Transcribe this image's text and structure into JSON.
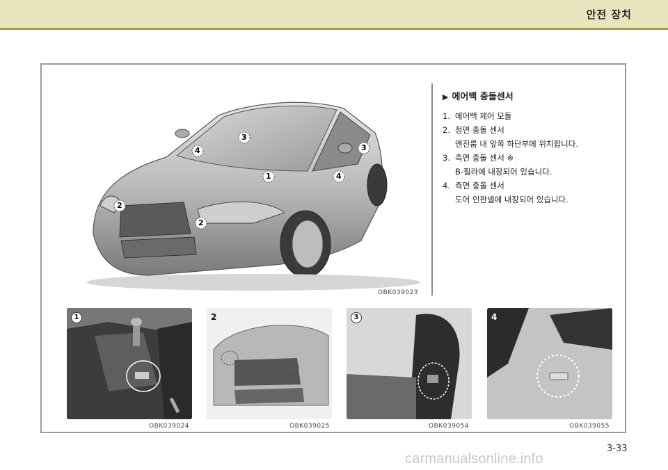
{
  "header": {
    "section_title": "안전 장치"
  },
  "main_figure": {
    "code": "OBK039023",
    "callouts": [
      "1",
      "2",
      "2",
      "3",
      "3",
      "4",
      "4"
    ]
  },
  "legend": {
    "title": "에어백 충돌센서",
    "items": [
      {
        "num": "1.",
        "text": "에어백 제어 모듈"
      },
      {
        "num": "2.",
        "text": "정면 충돌 센서",
        "sub": "엔진룸 내 앞쪽 하단부에 위치합니다."
      },
      {
        "num": "3.",
        "text": "측면 충돌 센서 ※",
        "sub": "B-필라에 내장되어 있습니다."
      },
      {
        "num": "4.",
        "text": "측면 충돌 센서",
        "sub": "도어 인판넬에 내장되어 있습니다."
      }
    ]
  },
  "thumbnails": [
    {
      "num": "1",
      "code": "OBK039024"
    },
    {
      "num": "2",
      "code": "OBK039025"
    },
    {
      "num": "3",
      "code": "OBK039054"
    },
    {
      "num": "4",
      "code": "OBK039055"
    }
  ],
  "page_number": "3-33",
  "watermark": "carmanualsonline.info"
}
